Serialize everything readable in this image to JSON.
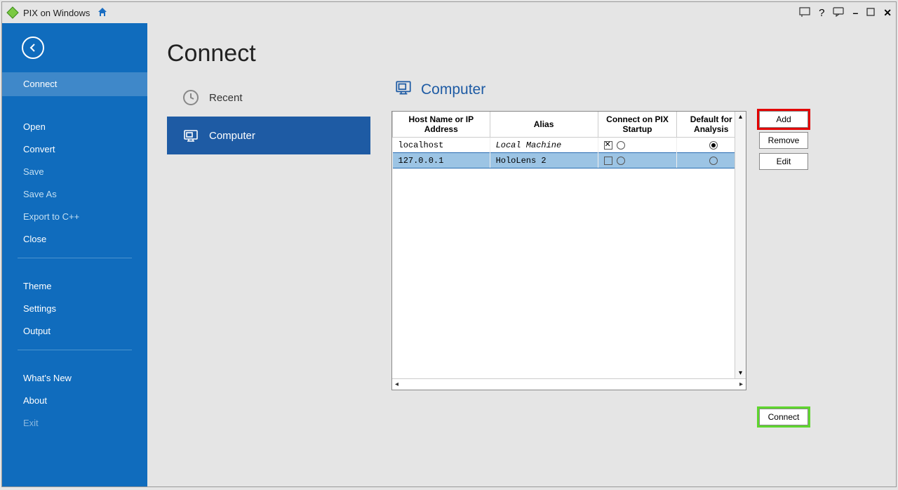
{
  "titlebar": {
    "title": "PIX on Windows"
  },
  "sidebar": {
    "selected": "Connect",
    "items_top": [
      "Connect"
    ],
    "items_file": [
      "Open",
      "Convert",
      "Save",
      "Save As",
      "Export to C++",
      "Close"
    ],
    "items_settings": [
      "Theme",
      "Settings",
      "Output"
    ],
    "items_about": [
      "What's New",
      "About",
      "Exit"
    ]
  },
  "page": {
    "title": "Connect",
    "categories": [
      {
        "label": "Recent",
        "selected": false
      },
      {
        "label": "Computer",
        "selected": true
      }
    ]
  },
  "panel": {
    "heading": "Computer",
    "columns": [
      "Host Name or IP Address",
      "Alias",
      "Connect on PIX Startup",
      "Default for Analysis"
    ],
    "rows": [
      {
        "host": "localhost",
        "alias": "Local Machine",
        "alias_italic": true,
        "connect_chk": true,
        "connect_radio": false,
        "default_radio": true,
        "selected": false
      },
      {
        "host": "127.0.0.1",
        "alias": "HoloLens 2",
        "alias_italic": false,
        "connect_chk": false,
        "connect_radio": false,
        "default_radio": false,
        "selected": true
      }
    ],
    "buttons": {
      "add": "Add",
      "remove": "Remove",
      "edit": "Edit",
      "connect": "Connect"
    }
  }
}
